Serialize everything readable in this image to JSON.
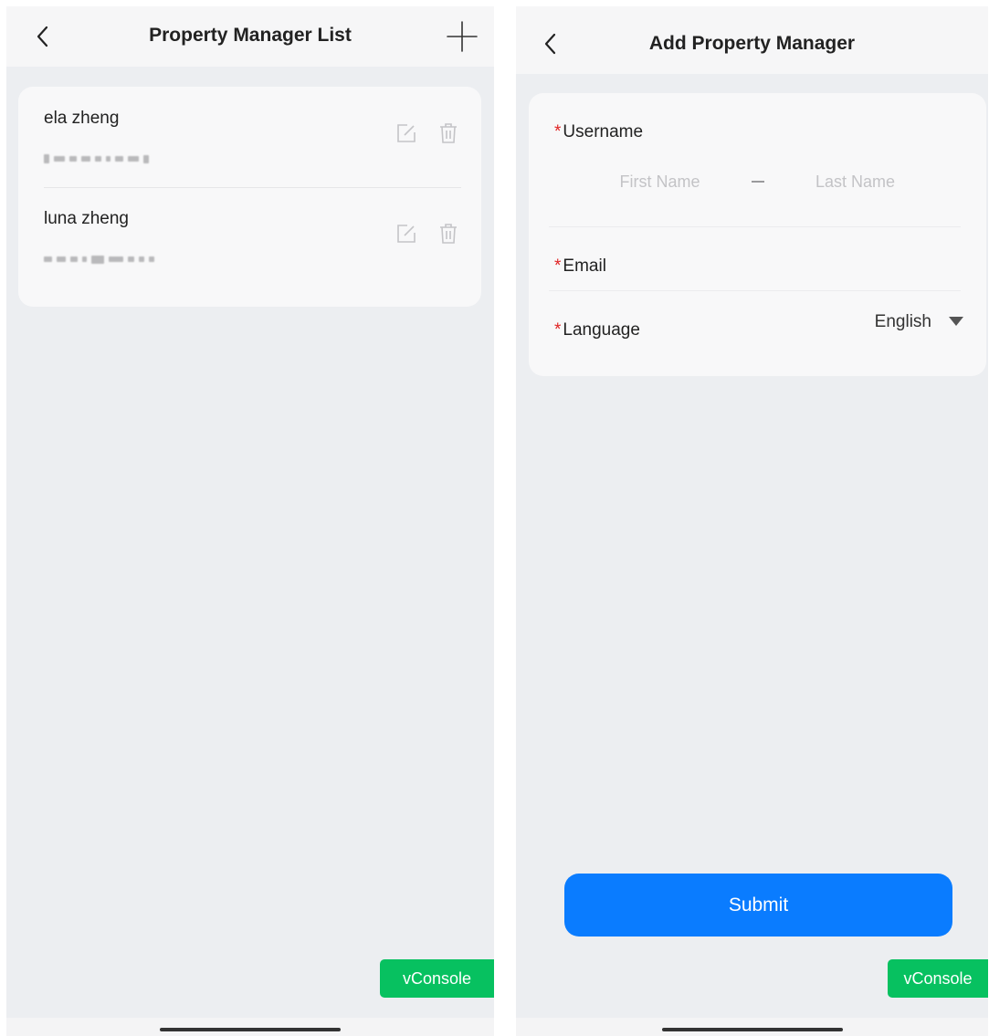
{
  "list_screen": {
    "title": "Property Manager List",
    "managers": [
      {
        "name": "ela zheng"
      },
      {
        "name": "luna zheng"
      }
    ],
    "vconsole_label": "vConsole"
  },
  "add_screen": {
    "title": "Add Property Manager",
    "required_marker": "*",
    "username_label": "Username",
    "first_name_placeholder": "First Name",
    "last_name_placeholder": "Last Name",
    "email_label": "Email",
    "language_label": "Language",
    "language_value": "English",
    "submit_label": "Submit",
    "vconsole_label": "vConsole"
  },
  "colors": {
    "primary_button": "#0a7cff",
    "vconsole_green": "#07c160",
    "required_red": "#e02424"
  },
  "icons": [
    "back-chevron-icon",
    "plus-icon",
    "edit-icon",
    "trash-icon",
    "dropdown-triangle-icon"
  ]
}
